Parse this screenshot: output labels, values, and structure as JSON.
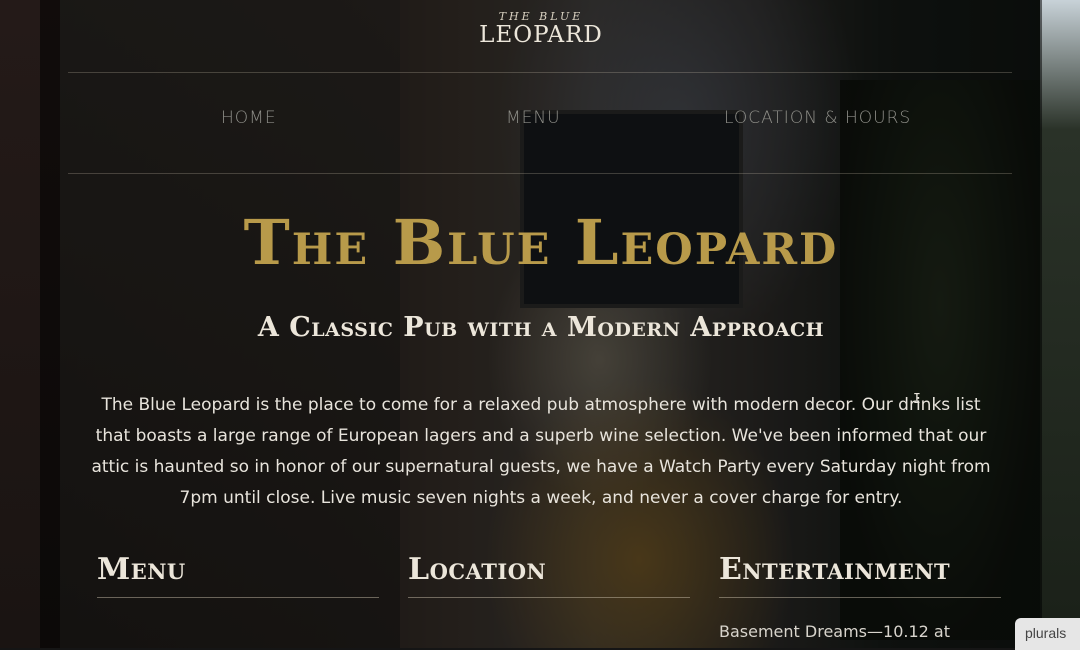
{
  "header": {
    "brand_small": "THE BLUE",
    "brand_big": "LEOPARD"
  },
  "nav": {
    "items": [
      {
        "label": "HOME"
      },
      {
        "label": "MENU"
      },
      {
        "label": "LOCATION & HOURS"
      }
    ]
  },
  "hero": {
    "title": "The Blue Leopard",
    "subtitle": "A Classic Pub with a Modern Approach",
    "intro": "The Blue Leopard is the place to come for a relaxed pub atmosphere with modern decor. Our drinks list that boasts a large range of European lagers and a superb wine selection. We've been informed that our attic is haunted so in honor of our supernatural guests, we have a Watch Party every Saturday night from 7pm until close. Live music seven nights a week, and never a cover charge for entry."
  },
  "columns": [
    {
      "heading": "Menu",
      "text": ""
    },
    {
      "heading": "Location",
      "text": ""
    },
    {
      "heading": "Entertainment",
      "text": "Basement Dreams—10.12 at"
    }
  ],
  "badge": {
    "label": "plurals"
  },
  "colors": {
    "accent_gold": "#b89a4a",
    "nav_text": "#8e8e88",
    "text_light": "#ece6da"
  }
}
